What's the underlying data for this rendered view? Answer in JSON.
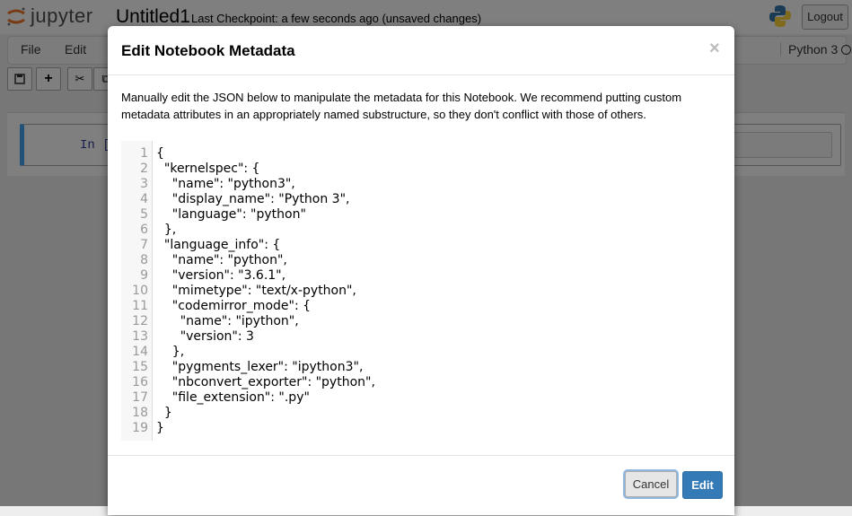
{
  "header": {
    "logo_text": "jupyter",
    "notebook_name": "Untitled1",
    "checkpoint_text": "Last Checkpoint: a few seconds ago (unsaved changes)",
    "logout_label": "Logout"
  },
  "menubar": {
    "items": [
      "File",
      "Edit"
    ],
    "kernel_label": "Python 3"
  },
  "cell": {
    "prompt": "In ["
  },
  "modal": {
    "title": "Edit Notebook Metadata",
    "close_glyph": "×",
    "description": "Manually edit the JSON below to manipulate the metadata for this Notebook. We recommend putting custom metadata attributes in an appropriately named substructure, so they don't conflict with those of others.",
    "code_lines": [
      "{",
      "  \"kernelspec\": {",
      "    \"name\": \"python3\",",
      "    \"display_name\": \"Python 3\",",
      "    \"language\": \"python\"",
      "  },",
      "  \"language_info\": {",
      "    \"name\": \"python\",",
      "    \"version\": \"3.6.1\",",
      "    \"mimetype\": \"text/x-python\",",
      "    \"codemirror_mode\": {",
      "      \"name\": \"ipython\",",
      "      \"version\": 3",
      "    },",
      "    \"pygments_lexer\": \"ipython3\",",
      "    \"nbconvert_exporter\": \"python\",",
      "    \"file_extension\": \".py\"",
      "  }",
      "}"
    ],
    "cancel_label": "Cancel",
    "edit_label": "Edit"
  },
  "colors": {
    "primary": "#337ab7",
    "cell_border": "#42a5f5",
    "prompt": "#303f9f"
  }
}
